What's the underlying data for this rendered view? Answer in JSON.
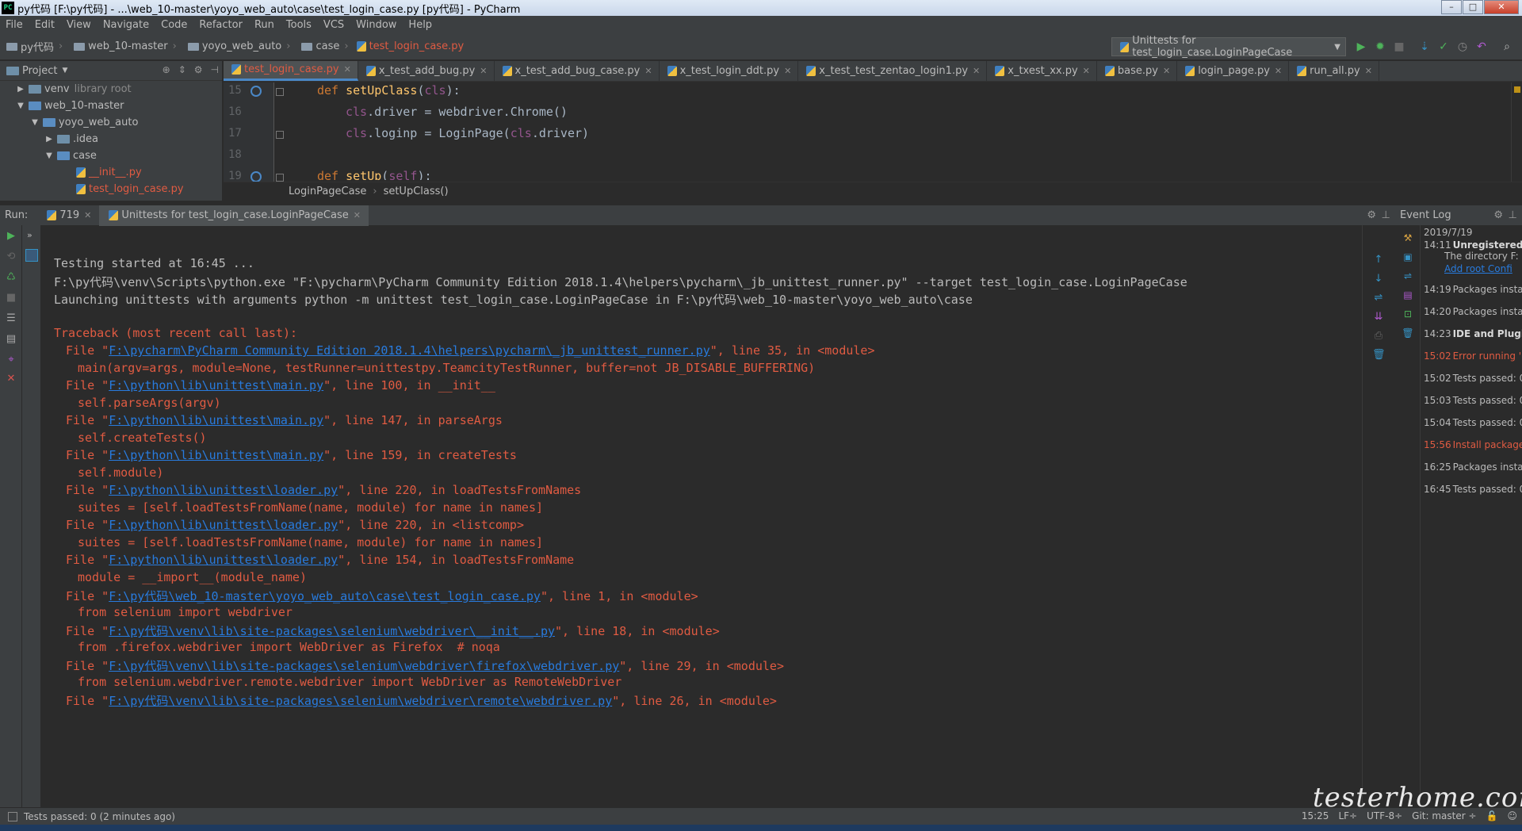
{
  "window": {
    "title": "py代码 [F:\\py代码] - ...\\web_10-master\\yoyo_web_auto\\case\\test_login_case.py [py代码] - PyCharm",
    "app_icon": "PC"
  },
  "menu": [
    "File",
    "Edit",
    "View",
    "Navigate",
    "Code",
    "Refactor",
    "Run",
    "Tools",
    "VCS",
    "Window",
    "Help"
  ],
  "breadcrumbs": [
    "py代码",
    "web_10-master",
    "yoyo_web_auto",
    "case",
    "test_login_case.py"
  ],
  "run_config": {
    "label": "Unittests for test_login_case.LoginPageCase"
  },
  "project": {
    "title": "Project",
    "tree": [
      {
        "label": "venv",
        "note": "library root",
        "depth": 0,
        "expanded": false
      },
      {
        "label": "web_10-master",
        "note": "",
        "depth": 0,
        "expanded": true
      },
      {
        "label": "yoyo_web_auto",
        "note": "",
        "depth": 1,
        "expanded": true
      },
      {
        "label": ".idea",
        "note": "",
        "depth": 2,
        "expanded": false
      },
      {
        "label": "case",
        "note": "",
        "depth": 2,
        "expanded": true
      },
      {
        "label": "__init__.py",
        "note": "",
        "depth": 3,
        "file": true
      },
      {
        "label": "test_login_case.py",
        "note": "",
        "depth": 3,
        "file": true
      }
    ]
  },
  "editor": {
    "tabs": [
      {
        "label": "test_login_case.py",
        "active": true
      },
      {
        "label": "x_test_add_bug.py",
        "active": false
      },
      {
        "label": "x_test_add_bug_case.py",
        "active": false
      },
      {
        "label": "x_test_login_ddt.py",
        "active": false
      },
      {
        "label": "x_test_test_zentao_login1.py",
        "active": false
      },
      {
        "label": "x_txest_xx.py",
        "active": false
      },
      {
        "label": "base.py",
        "active": false
      },
      {
        "label": "login_page.py",
        "active": false
      },
      {
        "label": "run_all.py",
        "active": false
      }
    ],
    "line_numbers": [
      "15",
      "16",
      "17",
      "18",
      "19"
    ],
    "code": {
      "l15_kw": "def ",
      "l15_fn": "setUpClass",
      "l15_a": "(",
      "l15_self": "cls",
      "l15_b": "):",
      "l16_self": "cls",
      "l16_rest": ".driver = webdriver.Chrome()",
      "l17_self": "cls",
      "l17_rest": ".loginp = LoginPage(",
      "l17_self2": "cls",
      "l17_end": ".driver)",
      "l19_kw": "def ",
      "l19_fn": "setUp",
      "l19_a": "(",
      "l19_self": "self",
      "l19_b": "):"
    },
    "breadcrumb": [
      "LoginPageCase",
      "setUpClass()"
    ]
  },
  "run_panel": {
    "label": "Run:",
    "tabs": [
      {
        "label": "719"
      },
      {
        "label": "Unittests for test_login_case.LoginPageCase"
      }
    ]
  },
  "console": {
    "line1": "Testing started at 16:45 ...",
    "line2": "F:\\py代码\\venv\\Scripts\\python.exe \"F:\\pycharm\\PyCharm Community Edition 2018.1.4\\helpers\\pycharm\\_jb_unittest_runner.py\" --target test_login_case.LoginPageCase",
    "line3": "Launching unittests with arguments python -m unittest test_login_case.LoginPageCase in F:\\py代码\\web_10-master\\yoyo_web_auto\\case",
    "traceback_header": "Traceback (most recent call last):",
    "frames": [
      {
        "file": "F:\\pycharm\\PyCharm Community Edition 2018.1.4\\helpers\\pycharm\\_jb_unittest_runner.py",
        "tail": "\", line 35, in <module>",
        "code": "main(argv=args, module=None, testRunner=unittestpy.TeamcityTestRunner, buffer=not JB_DISABLE_BUFFERING)"
      },
      {
        "file": "F:\\python\\lib\\unittest\\main.py",
        "tail": "\", line 100, in __init__",
        "code": "self.parseArgs(argv)"
      },
      {
        "file": "F:\\python\\lib\\unittest\\main.py",
        "tail": "\", line 147, in parseArgs",
        "code": "self.createTests()"
      },
      {
        "file": "F:\\python\\lib\\unittest\\main.py",
        "tail": "\", line 159, in createTests",
        "code": "self.module)"
      },
      {
        "file": "F:\\python\\lib\\unittest\\loader.py",
        "tail": "\", line 220, in loadTestsFromNames",
        "code": "suites = [self.loadTestsFromName(name, module) for name in names]"
      },
      {
        "file": "F:\\python\\lib\\unittest\\loader.py",
        "tail": "\", line 220, in <listcomp>",
        "code": "suites = [self.loadTestsFromName(name, module) for name in names]"
      },
      {
        "file": "F:\\python\\lib\\unittest\\loader.py",
        "tail": "\", line 154, in loadTestsFromName",
        "code": "module = __import__(module_name)"
      },
      {
        "file": "F:\\py代码\\web_10-master\\yoyo_web_auto\\case\\test_login_case.py",
        "tail": "\", line 1, in <module>",
        "code": "from selenium import webdriver"
      },
      {
        "file": "F:\\py代码\\venv\\lib\\site-packages\\selenium\\webdriver\\__init__.py",
        "tail": "\", line 18, in <module>",
        "code": "from .firefox.webdriver import WebDriver as Firefox  # noqa"
      },
      {
        "file": "F:\\py代码\\venv\\lib\\site-packages\\selenium\\webdriver\\firefox\\webdriver.py",
        "tail": "\", line 29, in <module>",
        "code": "from selenium.webdriver.remote.webdriver import WebDriver as RemoteWebDriver"
      },
      {
        "file": "F:\\py代码\\venv\\lib\\site-packages\\selenium\\webdriver\\remote\\webdriver.py",
        "tail": "\", line 26, in <module>",
        "code": ""
      }
    ],
    "file_prefix": "File \""
  },
  "event_log": {
    "title": "Event Log",
    "date": "2019/7/19",
    "entries": [
      {
        "time": "14:11",
        "text": "Unregistered",
        "bold": true,
        "red": false
      },
      {
        "time": "",
        "text": "The directory F:",
        "bold": false,
        "red": false
      },
      {
        "time": "",
        "text": "Add root  Confi",
        "bold": false,
        "red": false,
        "link": true
      },
      {
        "time": "14:19",
        "text": "Packages install",
        "bold": false,
        "red": false
      },
      {
        "time": "14:20",
        "text": "Packages install",
        "bold": false,
        "red": false
      },
      {
        "time": "14:23",
        "text": "IDE and Plugin",
        "bold": true,
        "red": false
      },
      {
        "time": "15:02",
        "text": "Error running 'U",
        "bold": false,
        "red": true
      },
      {
        "time": "15:02",
        "text": "Tests passed: 0",
        "bold": false,
        "red": false
      },
      {
        "time": "15:03",
        "text": "Tests passed: 0",
        "bold": false,
        "red": false
      },
      {
        "time": "15:04",
        "text": "Tests passed: 0",
        "bold": false,
        "red": false
      },
      {
        "time": "15:56",
        "text": "Install packages",
        "bold": false,
        "red": true
      },
      {
        "time": "16:25",
        "text": "Packages install",
        "bold": false,
        "red": false
      },
      {
        "time": "16:45",
        "text": "Tests passed: 0",
        "bold": false,
        "red": false
      }
    ]
  },
  "status": {
    "left": "Tests passed: 0 (2 minutes ago)",
    "position": "15:25",
    "line_sep": "LF÷",
    "encoding": "UTF-8÷",
    "git": "Git: master ÷"
  },
  "watermark": "testerhome.com"
}
